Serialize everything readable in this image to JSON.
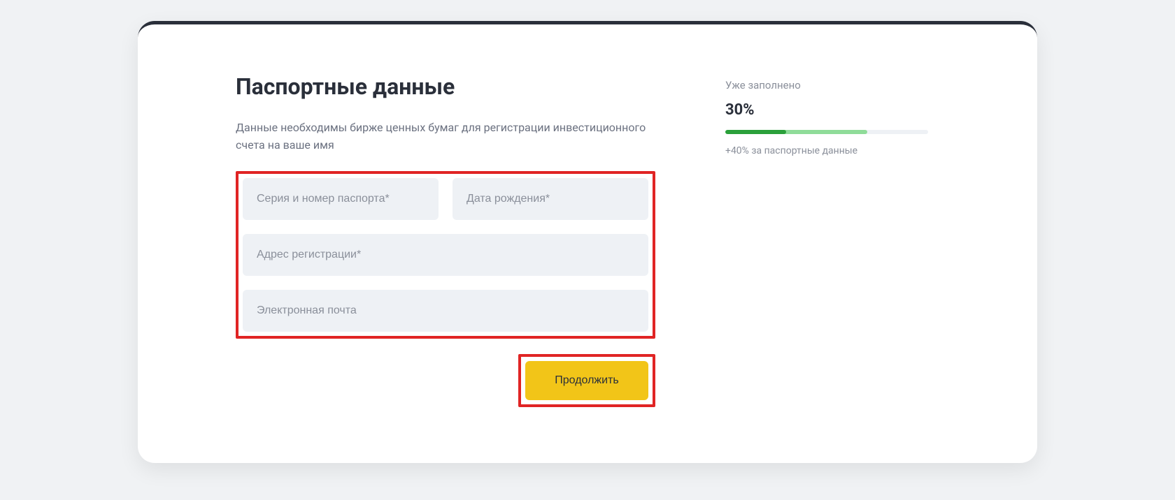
{
  "form": {
    "heading": "Паспортные данные",
    "subheading": "Данные необходимы бирже ценных бумаг для регистрации инвестиционного счета на ваше имя",
    "fields": {
      "passport": {
        "placeholder": "Серия и номер паспорта*",
        "value": ""
      },
      "birthdate": {
        "placeholder": "Дата рождения*",
        "value": ""
      },
      "address": {
        "placeholder": "Адрес регистрации*",
        "value": ""
      },
      "email": {
        "placeholder": "Электронная почта",
        "value": ""
      }
    },
    "continue_label": "Продолжить"
  },
  "progress": {
    "label": "Уже заполнено",
    "percent_text": "30%",
    "percent_done": 30,
    "percent_projected": 70,
    "hint": "+40% за паспортные данные"
  },
  "colors": {
    "highlight": "#e02424",
    "button": "#f2c518",
    "progress_dark": "#2aa03a",
    "progress_light": "#8fdc99"
  }
}
